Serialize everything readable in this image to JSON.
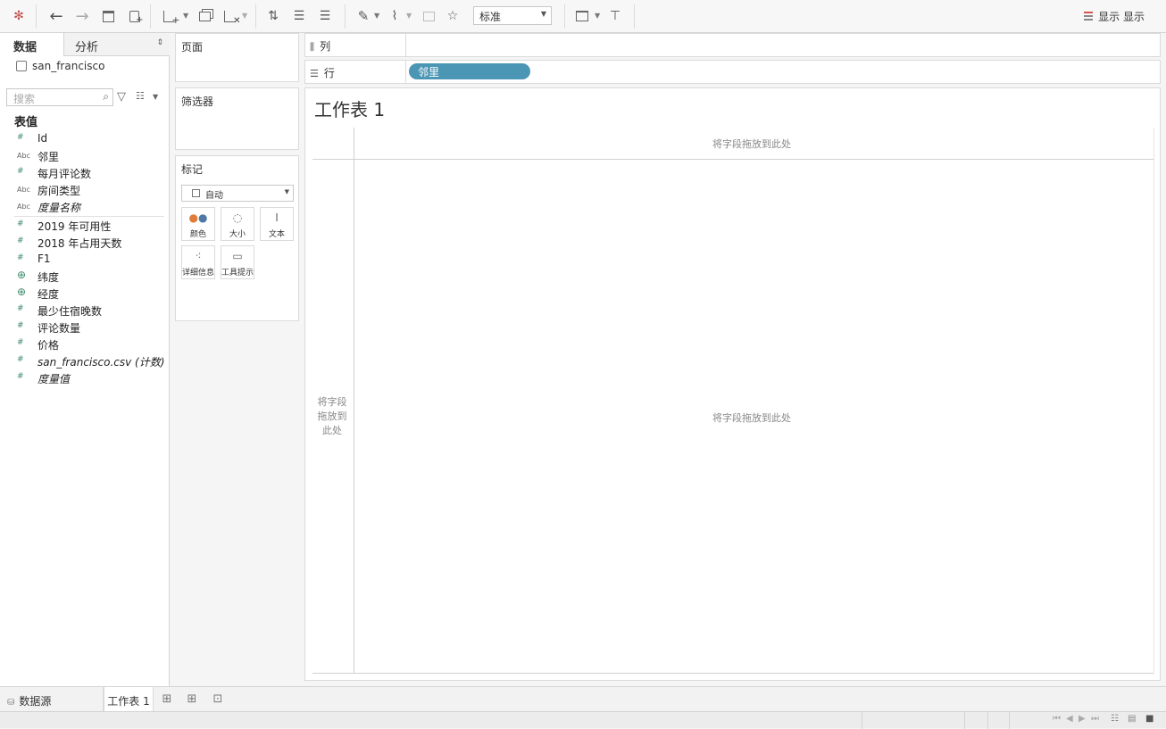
{
  "toolbar": {
    "icons": [
      "tableau-logo-icon",
      "undo-icon",
      "redo-icon",
      "save-icon",
      "new-datasource-icon",
      "new-worksheet-icon",
      "duplicate-sheet-icon",
      "clear-sheet-icon",
      "swap-icon",
      "sort-ascending-icon",
      "sort-descending-icon",
      "highlight-icon",
      "annotate-icon",
      "fix-axes-icon",
      "pin-icon",
      "show-cards-icon",
      "presentation-icon"
    ],
    "fit": "标准",
    "show_me": "显示 显示"
  },
  "left_pane": {
    "tabs": {
      "data": "数据",
      "analysis": "分析"
    },
    "datasource": "san_francisco",
    "search_placeholder": "搜索",
    "tables_header": "表值",
    "fields": [
      {
        "type": "#",
        "name": "Id"
      },
      {
        "type": "Abc",
        "name": "邻里"
      },
      {
        "type": "#",
        "name": "每月评论数"
      },
      {
        "type": "Abc",
        "name": "房间类型"
      },
      {
        "type": "Abc",
        "name": "度量名称"
      },
      {
        "type": "#",
        "name": "2019 年可用性"
      },
      {
        "type": "#",
        "name": "2018 年占用天数"
      },
      {
        "type": "#",
        "name": "F1"
      },
      {
        "type": "geo",
        "name": "纬度"
      },
      {
        "type": "geo",
        "name": "经度"
      },
      {
        "type": "#",
        "name": "最少住宿晚数"
      },
      {
        "type": "#",
        "name": "评论数量"
      },
      {
        "type": "#",
        "name": "价格"
      },
      {
        "type": "#",
        "name": "san_francisco.csv (计数)"
      },
      {
        "type": "#",
        "name": "度量值"
      }
    ]
  },
  "cards": {
    "pages": "页面",
    "filters": "筛选器",
    "marks": "标记",
    "marks_type": "自动",
    "mark_buttons": {
      "color": "颜色",
      "size": "大小",
      "text": "文本",
      "detail": "详细信息",
      "tooltip": "工具提示"
    }
  },
  "shelves": {
    "columns_label": "列",
    "rows_label": "行",
    "rows_pill": "邻里"
  },
  "sheet": {
    "title": "工作表 1",
    "drop_top": "将字段拖放到此处",
    "drop_left": "将字段拖放到此处",
    "drop_center": "将字段拖放到此处"
  },
  "bottom": {
    "datasource_tab": "数据源",
    "sheet_tab": "工作表 1"
  }
}
